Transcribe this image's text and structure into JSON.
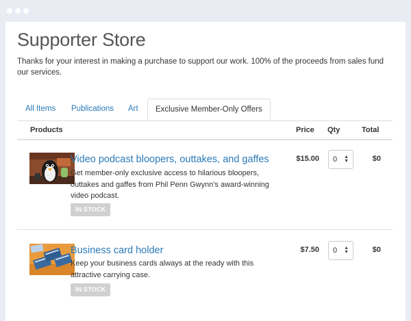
{
  "store": {
    "title": "Supporter Store",
    "intro": "Thanks for your interest in making a purchase to support our work. 100% of the proceeds from sales fund our services."
  },
  "tabs": [
    {
      "label": "All Items",
      "active": false
    },
    {
      "label": "Publications",
      "active": false
    },
    {
      "label": "Art",
      "active": false
    },
    {
      "label": "Exclusive Member-Only Offers",
      "active": true
    }
  ],
  "table": {
    "headers": {
      "products": "Products",
      "price": "Price",
      "qty": "Qty",
      "total": "Total"
    }
  },
  "products": [
    {
      "name": "Video podcast bloopers, outtakes, and gaffes",
      "description": "Get member-only exclusive access to hilarious bloopers, outtakes and gaffes from Phil Penn Gwynn's award-winning video podcast.",
      "stock": "IN STOCK",
      "price": "$15.00",
      "qty": "0",
      "total": "$0"
    },
    {
      "name": "Business card holder",
      "description": "Keep your business cards always at the ready with this attractive carrying case.",
      "stock": "IN STOCK",
      "price": "$7.50",
      "qty": "0",
      "total": "$0"
    }
  ],
  "colors": {
    "link": "#2a7ab8",
    "badge": "#d0d0d0",
    "window_chrome": "#e9edf3"
  }
}
